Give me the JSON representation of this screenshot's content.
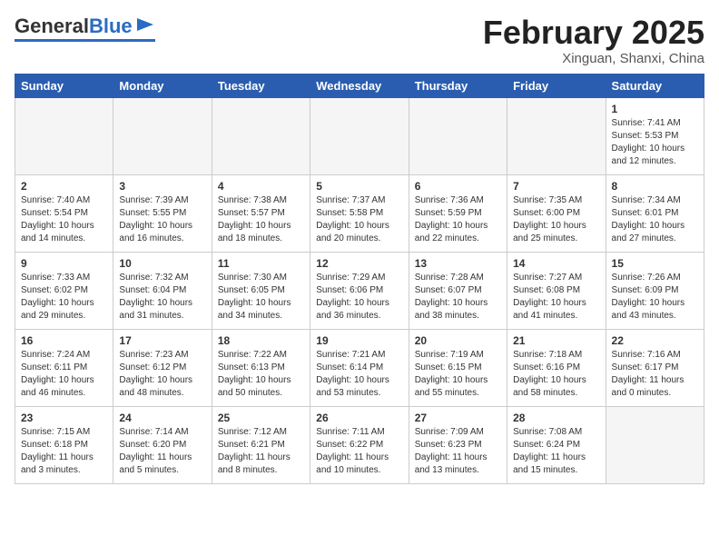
{
  "header": {
    "logo_general": "General",
    "logo_blue": "Blue",
    "month_title": "February 2025",
    "subtitle": "Xinguan, Shanxi, China"
  },
  "weekdays": [
    "Sunday",
    "Monday",
    "Tuesday",
    "Wednesday",
    "Thursday",
    "Friday",
    "Saturday"
  ],
  "weeks": [
    [
      {
        "day": "",
        "info": ""
      },
      {
        "day": "",
        "info": ""
      },
      {
        "day": "",
        "info": ""
      },
      {
        "day": "",
        "info": ""
      },
      {
        "day": "",
        "info": ""
      },
      {
        "day": "",
        "info": ""
      },
      {
        "day": "1",
        "info": "Sunrise: 7:41 AM\nSunset: 5:53 PM\nDaylight: 10 hours and 12 minutes."
      }
    ],
    [
      {
        "day": "2",
        "info": "Sunrise: 7:40 AM\nSunset: 5:54 PM\nDaylight: 10 hours and 14 minutes."
      },
      {
        "day": "3",
        "info": "Sunrise: 7:39 AM\nSunset: 5:55 PM\nDaylight: 10 hours and 16 minutes."
      },
      {
        "day": "4",
        "info": "Sunrise: 7:38 AM\nSunset: 5:57 PM\nDaylight: 10 hours and 18 minutes."
      },
      {
        "day": "5",
        "info": "Sunrise: 7:37 AM\nSunset: 5:58 PM\nDaylight: 10 hours and 20 minutes."
      },
      {
        "day": "6",
        "info": "Sunrise: 7:36 AM\nSunset: 5:59 PM\nDaylight: 10 hours and 22 minutes."
      },
      {
        "day": "7",
        "info": "Sunrise: 7:35 AM\nSunset: 6:00 PM\nDaylight: 10 hours and 25 minutes."
      },
      {
        "day": "8",
        "info": "Sunrise: 7:34 AM\nSunset: 6:01 PM\nDaylight: 10 hours and 27 minutes."
      }
    ],
    [
      {
        "day": "9",
        "info": "Sunrise: 7:33 AM\nSunset: 6:02 PM\nDaylight: 10 hours and 29 minutes."
      },
      {
        "day": "10",
        "info": "Sunrise: 7:32 AM\nSunset: 6:04 PM\nDaylight: 10 hours and 31 minutes."
      },
      {
        "day": "11",
        "info": "Sunrise: 7:30 AM\nSunset: 6:05 PM\nDaylight: 10 hours and 34 minutes."
      },
      {
        "day": "12",
        "info": "Sunrise: 7:29 AM\nSunset: 6:06 PM\nDaylight: 10 hours and 36 minutes."
      },
      {
        "day": "13",
        "info": "Sunrise: 7:28 AM\nSunset: 6:07 PM\nDaylight: 10 hours and 38 minutes."
      },
      {
        "day": "14",
        "info": "Sunrise: 7:27 AM\nSunset: 6:08 PM\nDaylight: 10 hours and 41 minutes."
      },
      {
        "day": "15",
        "info": "Sunrise: 7:26 AM\nSunset: 6:09 PM\nDaylight: 10 hours and 43 minutes."
      }
    ],
    [
      {
        "day": "16",
        "info": "Sunrise: 7:24 AM\nSunset: 6:11 PM\nDaylight: 10 hours and 46 minutes."
      },
      {
        "day": "17",
        "info": "Sunrise: 7:23 AM\nSunset: 6:12 PM\nDaylight: 10 hours and 48 minutes."
      },
      {
        "day": "18",
        "info": "Sunrise: 7:22 AM\nSunset: 6:13 PM\nDaylight: 10 hours and 50 minutes."
      },
      {
        "day": "19",
        "info": "Sunrise: 7:21 AM\nSunset: 6:14 PM\nDaylight: 10 hours and 53 minutes."
      },
      {
        "day": "20",
        "info": "Sunrise: 7:19 AM\nSunset: 6:15 PM\nDaylight: 10 hours and 55 minutes."
      },
      {
        "day": "21",
        "info": "Sunrise: 7:18 AM\nSunset: 6:16 PM\nDaylight: 10 hours and 58 minutes."
      },
      {
        "day": "22",
        "info": "Sunrise: 7:16 AM\nSunset: 6:17 PM\nDaylight: 11 hours and 0 minutes."
      }
    ],
    [
      {
        "day": "23",
        "info": "Sunrise: 7:15 AM\nSunset: 6:18 PM\nDaylight: 11 hours and 3 minutes."
      },
      {
        "day": "24",
        "info": "Sunrise: 7:14 AM\nSunset: 6:20 PM\nDaylight: 11 hours and 5 minutes."
      },
      {
        "day": "25",
        "info": "Sunrise: 7:12 AM\nSunset: 6:21 PM\nDaylight: 11 hours and 8 minutes."
      },
      {
        "day": "26",
        "info": "Sunrise: 7:11 AM\nSunset: 6:22 PM\nDaylight: 11 hours and 10 minutes."
      },
      {
        "day": "27",
        "info": "Sunrise: 7:09 AM\nSunset: 6:23 PM\nDaylight: 11 hours and 13 minutes."
      },
      {
        "day": "28",
        "info": "Sunrise: 7:08 AM\nSunset: 6:24 PM\nDaylight: 11 hours and 15 minutes."
      },
      {
        "day": "",
        "info": ""
      }
    ]
  ]
}
